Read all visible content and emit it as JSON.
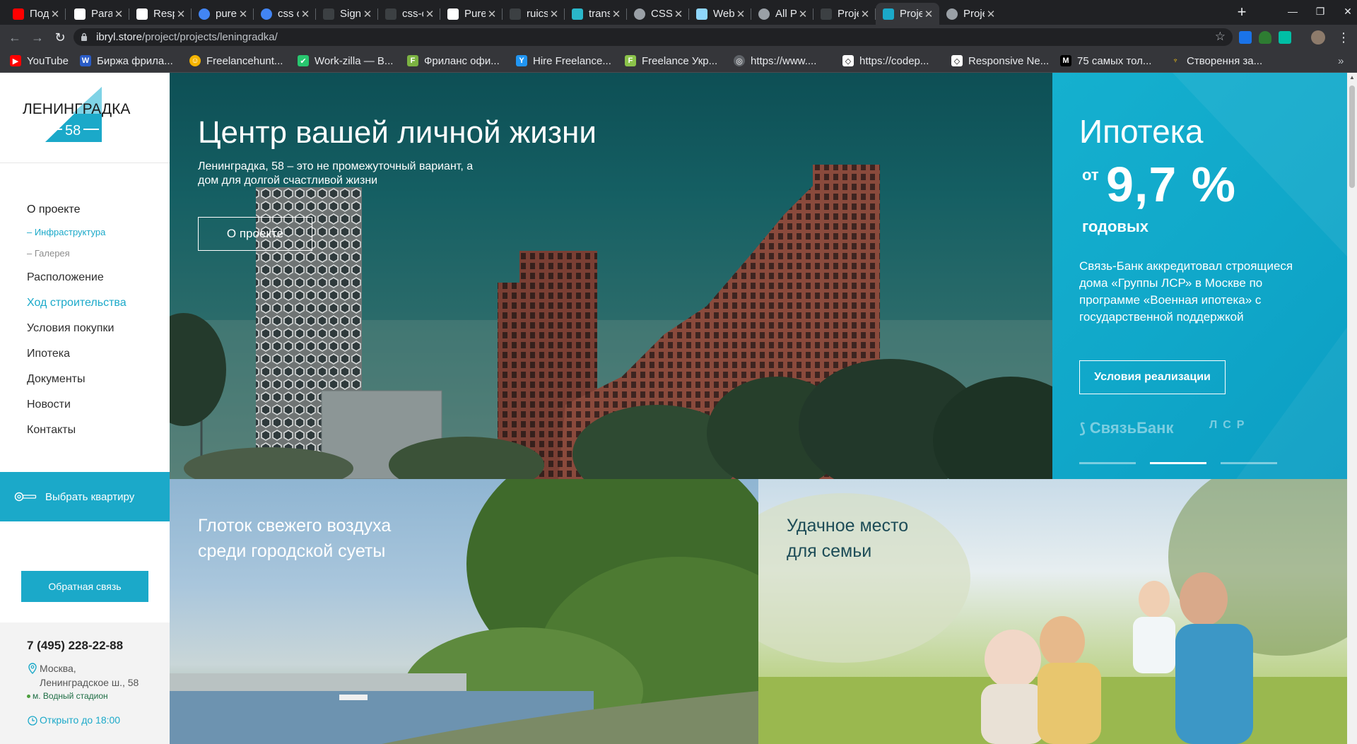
{
  "browser": {
    "tabs": [
      {
        "title": "Подпи",
        "favicon_color": "#ff0000"
      },
      {
        "title": "Paralla",
        "favicon_color": "#ffffff"
      },
      {
        "title": "Respo",
        "favicon_color": "#ffffff"
      },
      {
        "title": "pure c",
        "favicon_color": "#4285f4"
      },
      {
        "title": "css on",
        "favicon_color": "#4285f4"
      },
      {
        "title": "Signifi",
        "favicon_color": "#202124"
      },
      {
        "title": "css-on",
        "favicon_color": "#202124"
      },
      {
        "title": "Pure C",
        "favicon_color": "#ffffff"
      },
      {
        "title": "ruicse",
        "favicon_color": "#202124"
      },
      {
        "title": "transit",
        "favicon_color": "#2ab7ca"
      },
      {
        "title": "CSS O",
        "favicon_color": "#9aa0a6"
      },
      {
        "title": "Webpa",
        "favicon_color": "#8ed6fb"
      },
      {
        "title": "All Pro",
        "favicon_color": "#9aa0a6"
      },
      {
        "title": "Projec",
        "favicon_color": "#202124"
      },
      {
        "title": "Projec",
        "favicon_color": "#1ba9c9",
        "active": true
      },
      {
        "title": "Projec",
        "favicon_color": "#9aa0a6"
      }
    ],
    "url_host": "ibryl.store",
    "url_path": "/project/projects/leningradka/",
    "bookmarks": [
      {
        "label": "YouTube",
        "icon_color": "#ff0000",
        "glyph": "▶"
      },
      {
        "label": "Биржа фрила...",
        "icon_color": "#2a5cc7",
        "glyph": "W"
      },
      {
        "label": "Freelancehunt...",
        "icon_color": "#f5b400",
        "glyph": "☺"
      },
      {
        "label": "Work-zilla — В...",
        "icon_color": "#28c76f",
        "glyph": "✔"
      },
      {
        "label": "Фриланс офи...",
        "icon_color": "#7cb342",
        "glyph": "F"
      },
      {
        "label": "Hire Freelance...",
        "icon_color": "#2196f3",
        "glyph": "Y"
      },
      {
        "label": "Freelance Укр...",
        "icon_color": "#8bc34a",
        "glyph": "F"
      },
      {
        "label": "https://www....",
        "icon_color": "#9aa0a6",
        "glyph": "◎"
      },
      {
        "label": "https://codep...",
        "icon_color": "#ffffff",
        "glyph": "◇"
      },
      {
        "label": "Responsive Ne...",
        "icon_color": "#ffffff",
        "glyph": "◇"
      },
      {
        "label": "75 самых тол...",
        "icon_color": "#000000",
        "glyph": "M"
      },
      {
        "label": "Створення за...",
        "icon_color": "#f5c518",
        "glyph": "♆"
      }
    ]
  },
  "sidebar": {
    "logo_text": "ЛЕНИНГРАДКА",
    "logo_number": "58",
    "nav": [
      {
        "label": "О проекте"
      },
      {
        "label": "– Инфраструктура"
      },
      {
        "label": "– Галерея"
      },
      {
        "label": "Расположение"
      },
      {
        "label": "Ход строительства"
      },
      {
        "label": "Условия покупки"
      },
      {
        "label": "Ипотека"
      },
      {
        "label": "Документы"
      },
      {
        "label": "Новости"
      },
      {
        "label": "Контакты"
      }
    ],
    "choose_flat": "Выбрать квартиру",
    "feedback": "Обратная связь",
    "phone": "7 (495) 228-22-88",
    "address_line1": "Москва,",
    "address_line2": "Ленинградское ш., 58",
    "metro": "м. Водный стадион",
    "hours": "Открыто до 18:00"
  },
  "hero": {
    "title": "Центр вашей личной жизни",
    "subtitle": "Ленинградка, 58 – это не промежуточный вариант, а дом для долгой счастливой жизни",
    "button": "О проекте"
  },
  "mortgage": {
    "title": "Ипотека",
    "from": "от",
    "rate": "9,7 %",
    "years": "годовых",
    "text": "Связь-Банк аккредитовал строящиеся дома «Группы ЛСР» в Москве по программе «Военная ипотека» с государственной поддержкой",
    "button": "Условия реализации",
    "bank_logo": "СвязьБанк",
    "lsr_logo": "ЛСР",
    "slides_total": 3,
    "slide_active": 2
  },
  "tiles": [
    {
      "title_line1": "Глоток свежего воздуха",
      "title_line2": "среди городской суеты"
    },
    {
      "title_line1": "Удачное место",
      "title_line2": "для семьи"
    }
  ],
  "colors": {
    "accent": "#1ba9c9",
    "text": "#2f2f2f",
    "chrome_dark": "#202124"
  }
}
